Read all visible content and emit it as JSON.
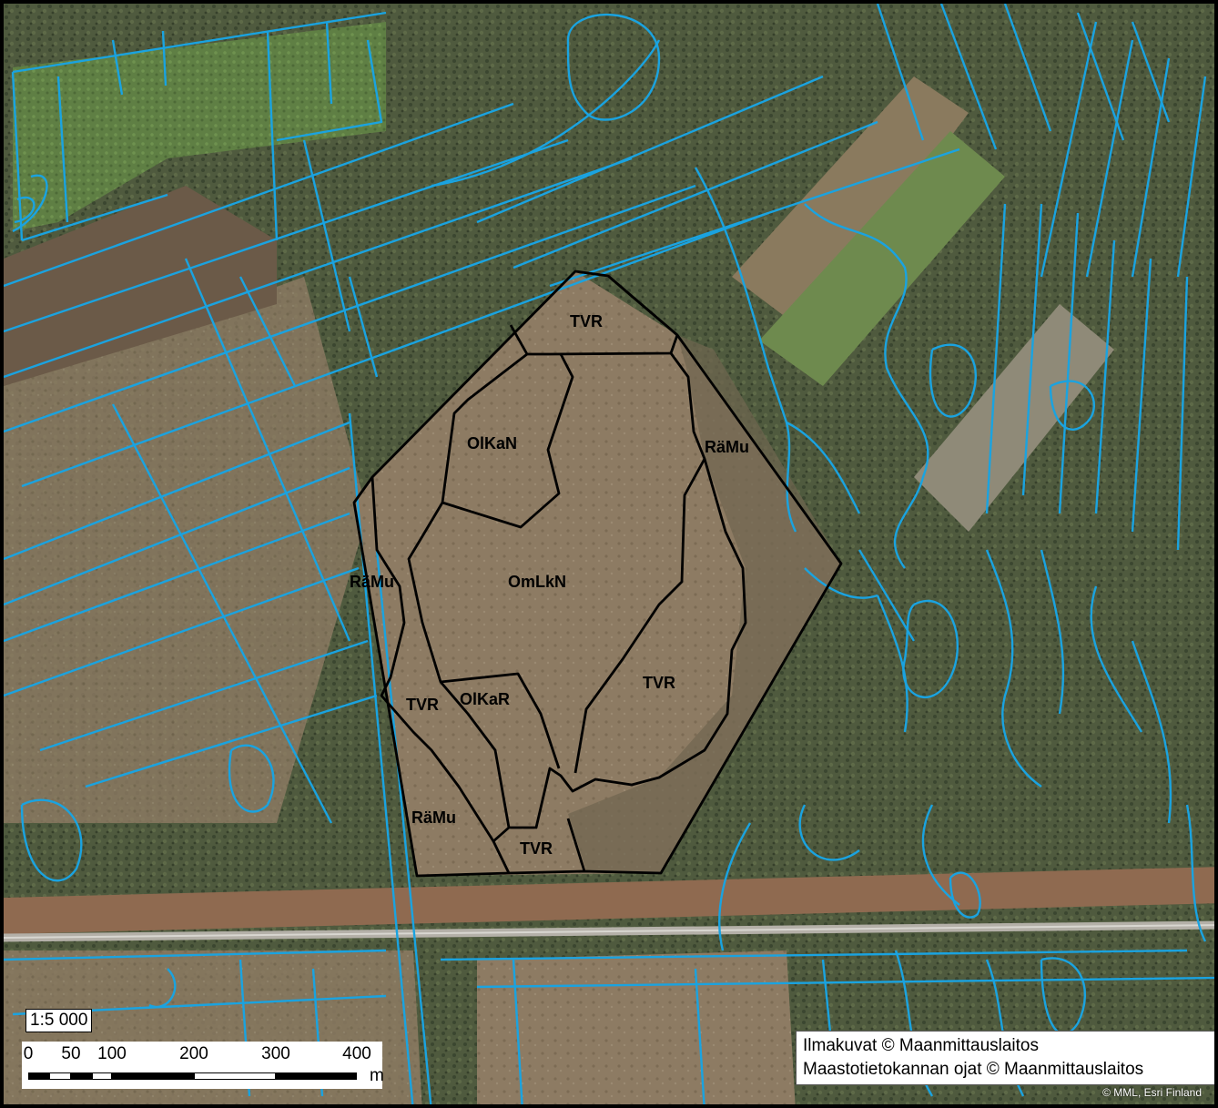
{
  "map": {
    "scale": "1:5 000",
    "scalebar": {
      "ticks": [
        "0",
        "50",
        "100",
        "200",
        "300",
        "400"
      ],
      "tick_values": [
        0,
        50,
        100,
        200,
        300,
        400
      ],
      "unit": "m"
    },
    "credits": [
      "Ilmakuvat © Maanmittauslaitos",
      "Maastotietokannan ojat © Maanmittauslaitos"
    ],
    "esri_credit": "© MML, Esri Finland",
    "polygon_labels": [
      "TVR",
      "OlKaN",
      "RäMu",
      "RäMu",
      "OmLkN",
      "TVR",
      "TVR",
      "OlKaR",
      "RäMu",
      "TVR"
    ],
    "colors": {
      "ditch": "#1aa3e0",
      "boundary": "#000000",
      "mire": "#8c7a62",
      "forest": "#4a5a3a",
      "field": "#6b8a4a",
      "road": "#9a8e82"
    }
  }
}
